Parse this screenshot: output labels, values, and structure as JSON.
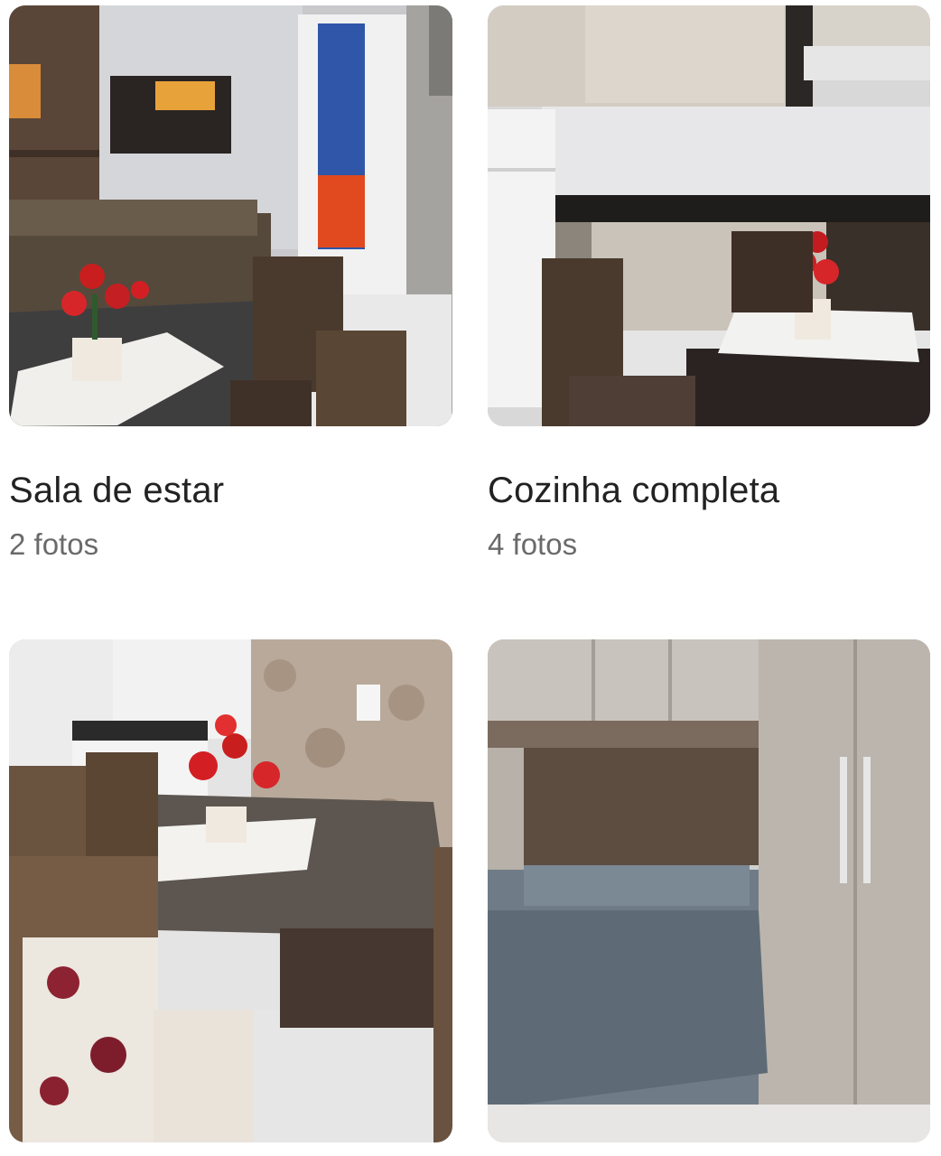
{
  "rooms": [
    {
      "title": "Sala de estar",
      "count": "2 fotos",
      "photo_icon": "living-room-photo"
    },
    {
      "title": "Cozinha completa",
      "count": "4 fotos",
      "photo_icon": "kitchen-photo"
    },
    {
      "title": "",
      "count": "",
      "photo_icon": "dining-area-photo"
    },
    {
      "title": "",
      "count": "",
      "photo_icon": "bedroom-photo"
    }
  ]
}
